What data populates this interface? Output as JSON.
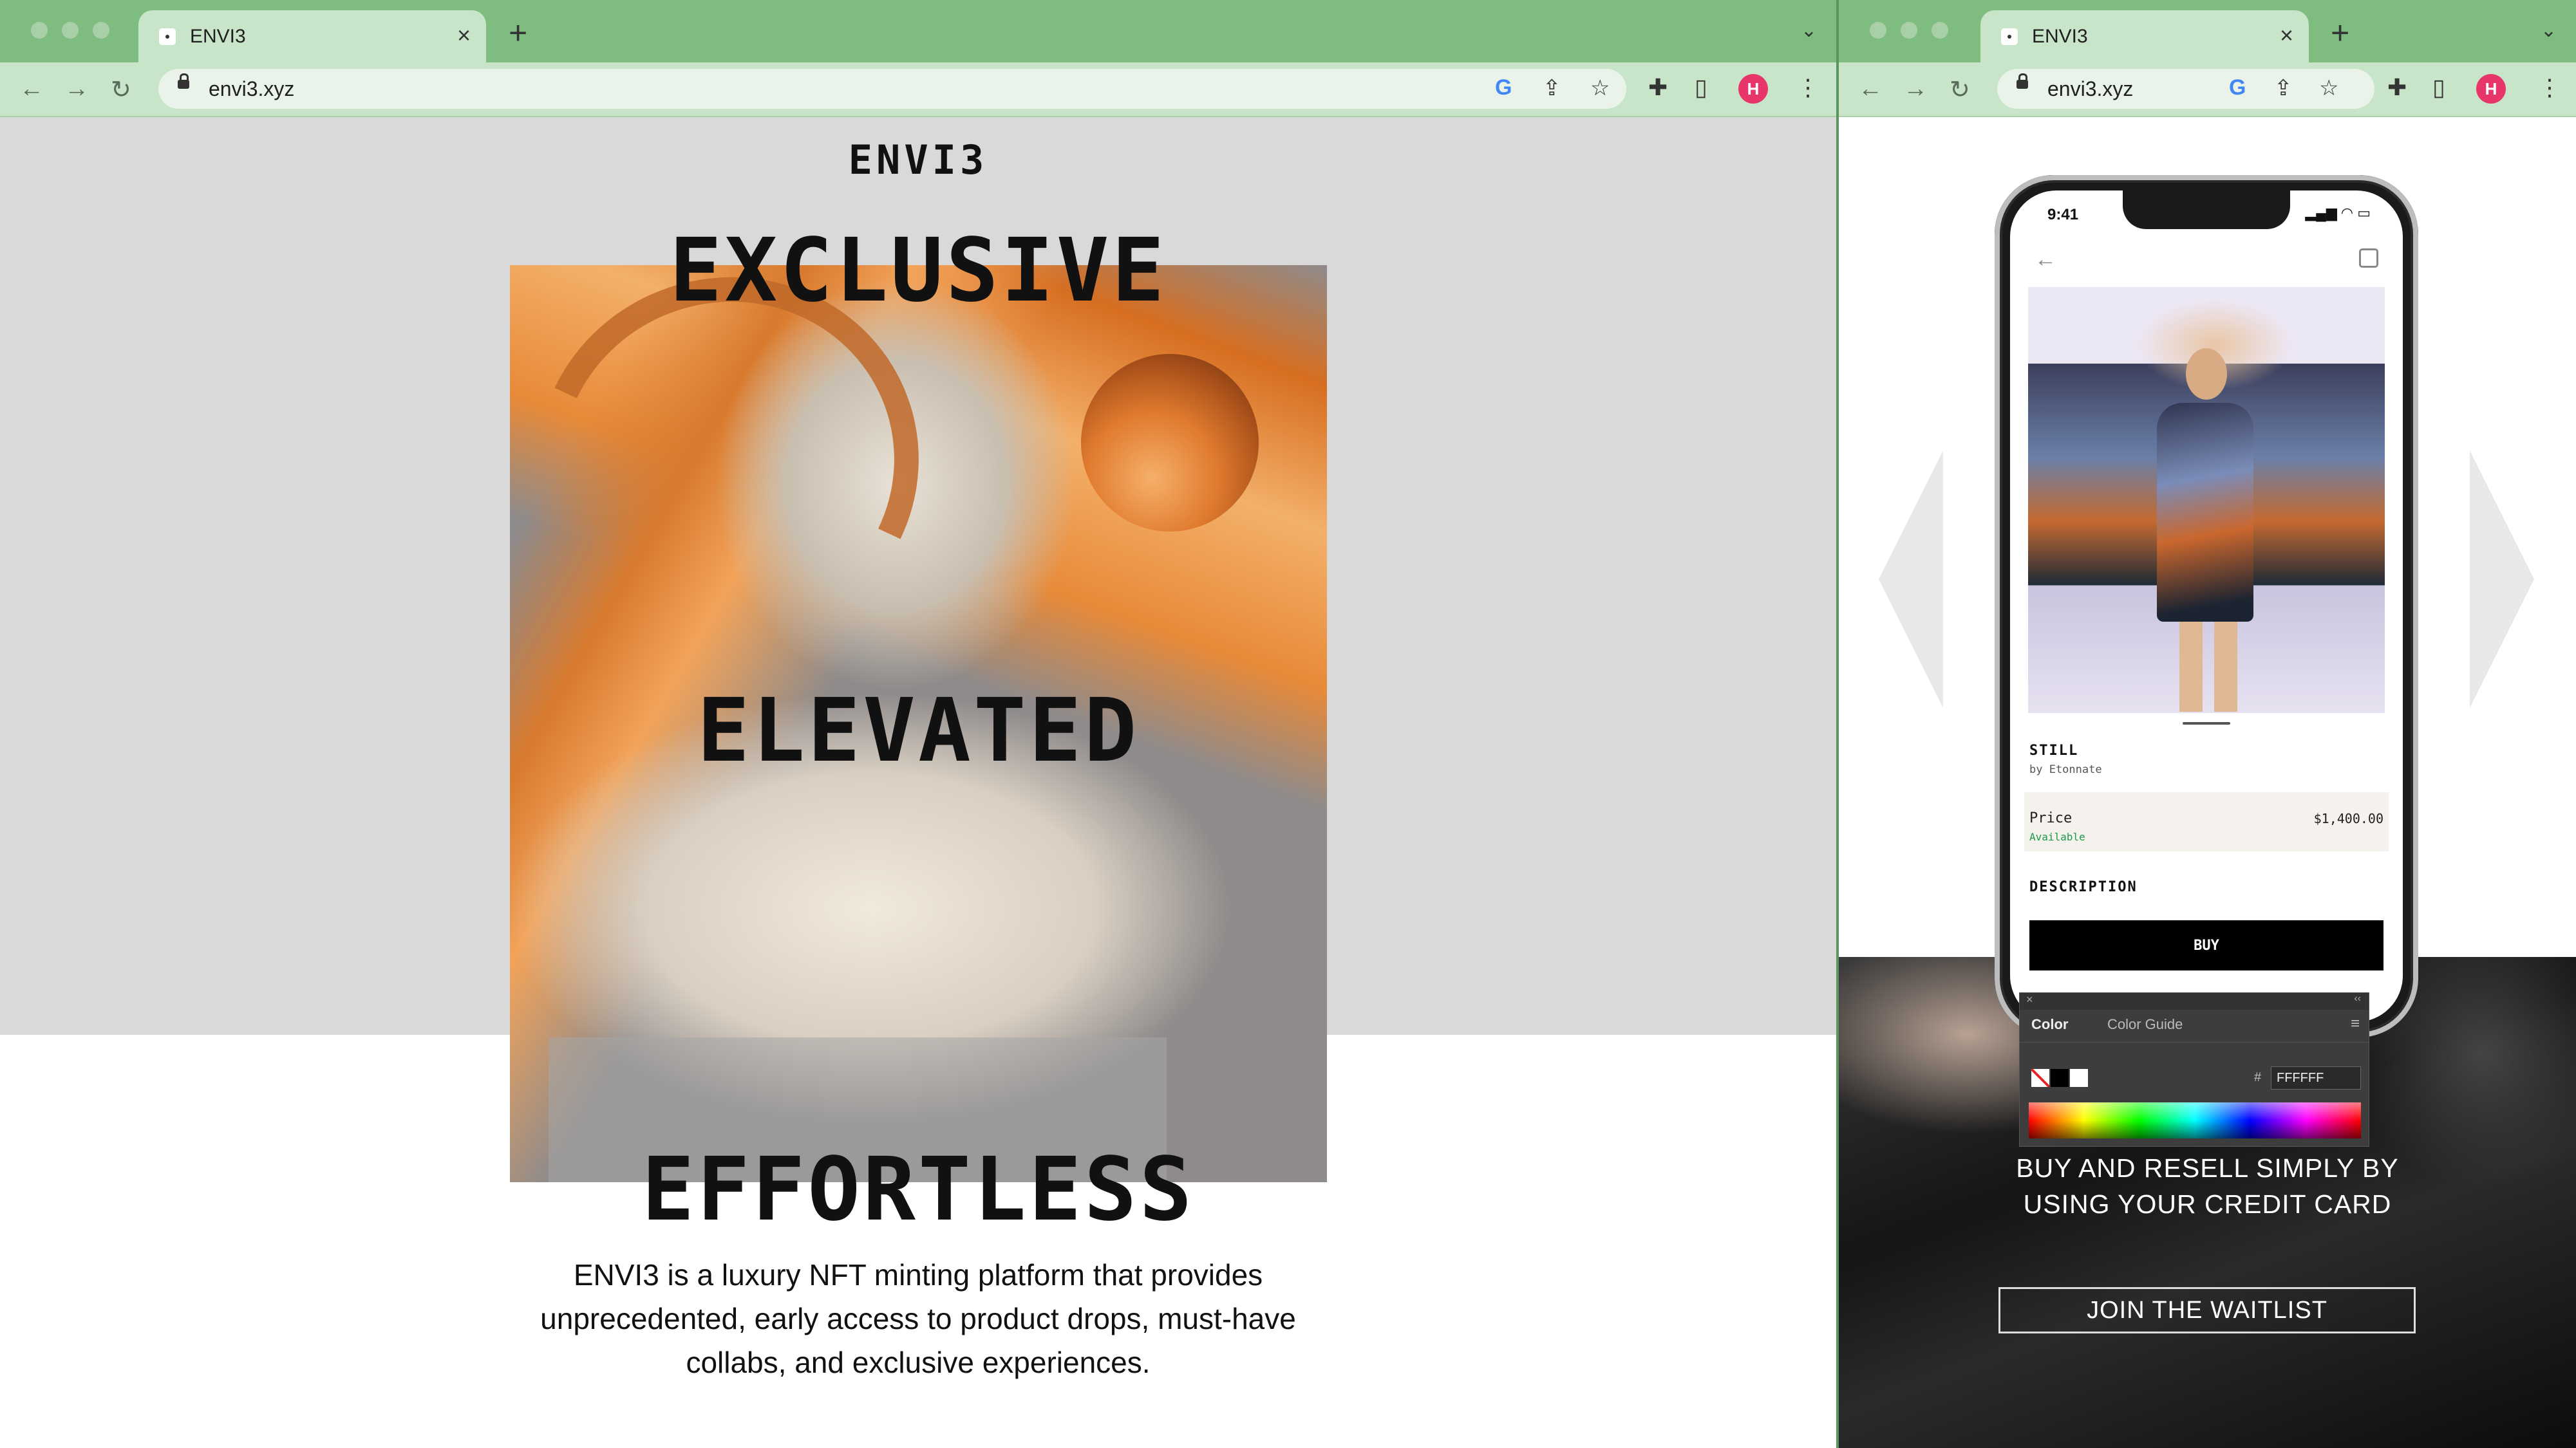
{
  "left_window": {
    "tab_title": "ENVI3",
    "url": "envi3.xyz",
    "avatar_initial": "H",
    "logo": "ENVI3",
    "headlines": [
      "EXCLUSIVE",
      "ELEVATED",
      "EFFORTLESS"
    ],
    "description": "ENVI3 is a luxury NFT minting platform that provides unprecedented, early access to product drops, must-have collabs, and exclusive experiences."
  },
  "right_window": {
    "tab_title": "ENVI3",
    "url": "envi3.xyz",
    "avatar_initial": "H",
    "phone": {
      "status_time": "9:41",
      "product_name": "STILL",
      "product_by": "by Etonnate",
      "price_label": "Price",
      "availability": "Available",
      "price_value": "$1,400.00",
      "description_label": "DESCRIPTION",
      "buy_label": "BUY"
    },
    "color_panel": {
      "tab_color": "Color",
      "tab_color_guide": "Color Guide",
      "hash": "#",
      "hex_value": "FFFFFF"
    },
    "headline_line1": "BUY AND RESELL SIMPLY BY",
    "headline_line2": "USING YOUR CREDIT CARD",
    "waitlist_label": "JOIN THE WAITLIST"
  },
  "icons": {
    "tab_close": "×",
    "new_tab": "+",
    "tab_menu": "⌄",
    "back": "←",
    "forward": "→",
    "reload": "↻",
    "google": "G",
    "share": "⇪",
    "bookmark": "☆",
    "extensions": "✚",
    "sidepanel": "▯",
    "menu": "⋮"
  },
  "colors": {
    "chrome_tabbar": "#7fbc7f",
    "chrome_toolbar": "#c9e5c9",
    "hero_grey": "#d9d9d9",
    "available_green": "#1a9a45",
    "avatar_pink": "#e8356a"
  }
}
